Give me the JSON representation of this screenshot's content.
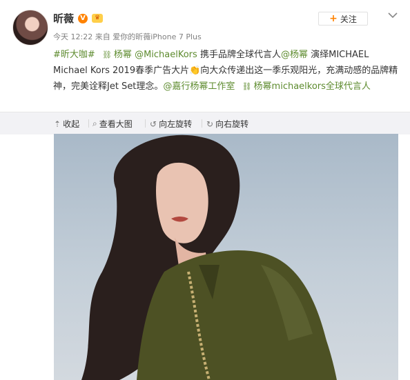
{
  "post": {
    "user": {
      "name": "昕薇"
    },
    "meta": {
      "time": "今天 12:22",
      "source_prefix": "来自",
      "source": "爱你的昕薇iPhone 7 Plus"
    },
    "follow_label": "关注",
    "content": {
      "hashtag": "#昕大咖#",
      "mention1_icon": "chain-icon",
      "mention1": "杨幂",
      "mention2": "@MichaelKors",
      "text1": "携手品牌全球代言人",
      "mention3": "@杨幂",
      "text2": "演绎MICHAEL Michael Kors 2019春季广告大片👏向大众传递出这一季乐观阳光，充满动感的品牌精神，完美诠释Jet Set理念。",
      "mention4": "@嘉行杨幂工作室",
      "mention5": "杨幂michaelkors全球代言人"
    },
    "toolbar": {
      "collapse": "收起",
      "view_large": "查看大图",
      "rotate_left": "向左旋转",
      "rotate_right": "向右旋转"
    },
    "icons": [
      "verify-icon",
      "vip-icon",
      "chevron-down-icon",
      "collapse-icon",
      "search-icon",
      "rotate-left-icon",
      "rotate-right-icon",
      "chain-icon"
    ]
  }
}
